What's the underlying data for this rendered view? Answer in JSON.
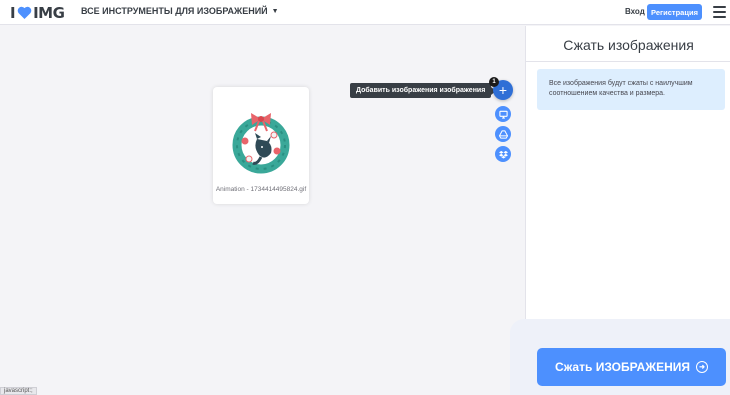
{
  "header": {
    "logo_left": "I",
    "logo_right": "IMG",
    "tools_menu_label": "ВСЕ ИНСТРУМЕНТЫ ДЛЯ ИЗОБРАЖЕНИЙ",
    "login_label": "Вход",
    "register_label": "Регистрация"
  },
  "workarea": {
    "file": {
      "name": "Animation - 1734414495824.gif"
    },
    "add_tooltip": "Добавить изображения изображения",
    "file_count": "1"
  },
  "sidebar": {
    "title": "Сжать изображения",
    "info_text": "Все изображения будут сжаты с наилучшим соотношением качества и размера.",
    "compress_label": "Сжать ИЗОБРАЖЕНИЯ"
  },
  "status_bar": {
    "text": "javascript:;"
  },
  "colors": {
    "accent": "#4d90fe",
    "accent_dark": "#2f6fd6",
    "heart": "#4d90fe",
    "info_bg": "#ddeefe"
  }
}
